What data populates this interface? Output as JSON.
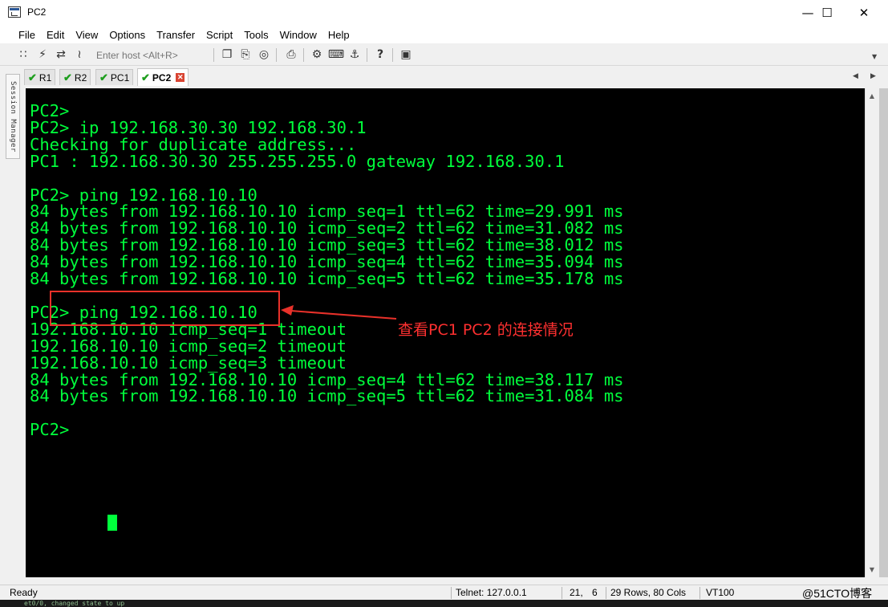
{
  "window": {
    "title": "PC2"
  },
  "menu": [
    "File",
    "Edit",
    "View",
    "Options",
    "Transfer",
    "Script",
    "Tools",
    "Window",
    "Help"
  ],
  "toolbar": {
    "host_placeholder": "Enter host <Alt+R>"
  },
  "session_manager": "Session Manager",
  "tabs": [
    {
      "label": "R1",
      "active": false
    },
    {
      "label": "R2",
      "active": false
    },
    {
      "label": "PC1",
      "active": false
    },
    {
      "label": "PC2",
      "active": true
    }
  ],
  "terminal": {
    "lines": [
      "PC2>",
      "PC2> ip 192.168.30.30 192.168.30.1",
      "Checking for duplicate address...",
      "PC1 : 192.168.30.30 255.255.255.0 gateway 192.168.30.1",
      "",
      "PC2> ping 192.168.10.10",
      "84 bytes from 192.168.10.10 icmp_seq=1 ttl=62 time=29.991 ms",
      "84 bytes from 192.168.10.10 icmp_seq=2 ttl=62 time=31.082 ms",
      "84 bytes from 192.168.10.10 icmp_seq=3 ttl=62 time=38.012 ms",
      "84 bytes from 192.168.10.10 icmp_seq=4 ttl=62 time=35.094 ms",
      "84 bytes from 192.168.10.10 icmp_seq=5 ttl=62 time=35.178 ms",
      "",
      "PC2> ping 192.168.10.10",
      "192.168.10.10 icmp_seq=1 timeout",
      "192.168.10.10 icmp_seq=2 timeout",
      "192.168.10.10 icmp_seq=3 timeout",
      "84 bytes from 192.168.10.10 icmp_seq=4 ttl=62 time=38.117 ms",
      "84 bytes from 192.168.10.10 icmp_seq=5 ttl=62 time=31.084 ms",
      "",
      "PC2> "
    ]
  },
  "annotation": {
    "text": "查看PC1 PC2 的连接情况"
  },
  "status": {
    "state": "Ready",
    "connection": "Telnet: 127.0.0.1",
    "row": "21,",
    "col": "6",
    "size": "29 Rows, 80 Cols",
    "emulation": "VT100",
    "watermark": "@51CTO博客"
  },
  "background_strip": "et0/0, changed state to up"
}
